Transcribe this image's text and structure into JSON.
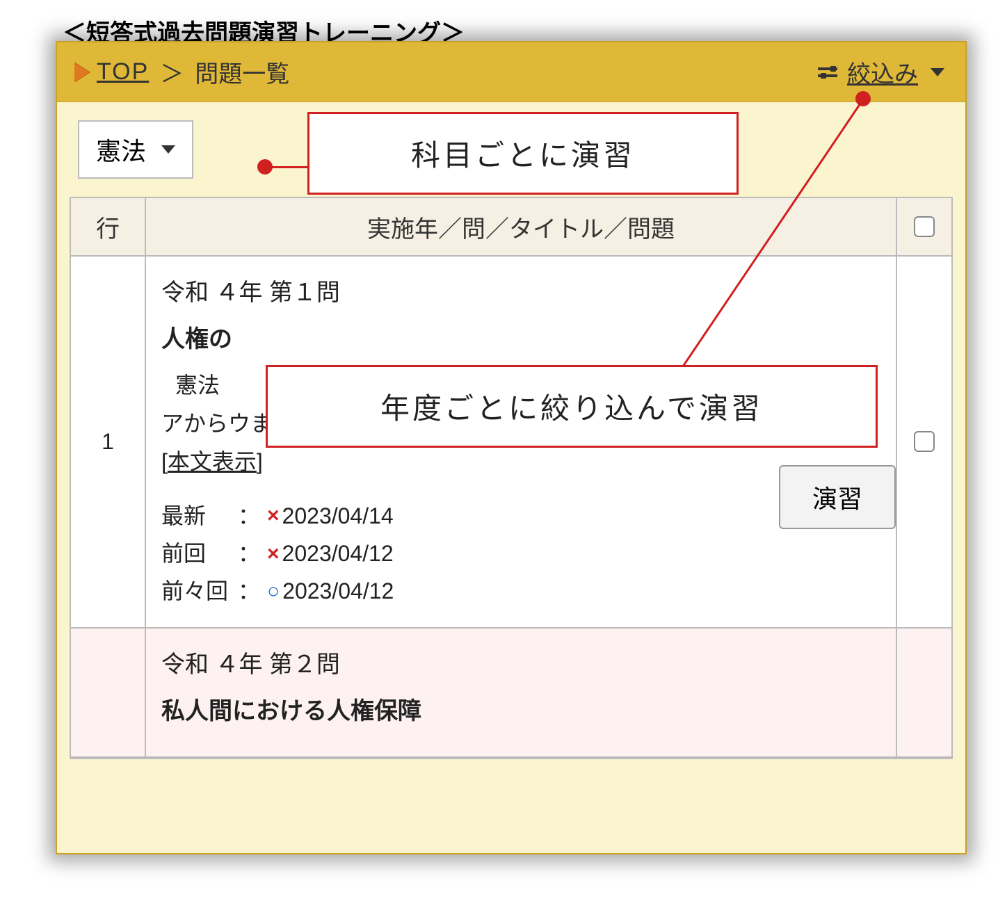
{
  "page_title": "＜短答式過去問題演習トレーニング＞",
  "breadcrumb": {
    "top": "TOP",
    "sep": "＞",
    "current": "問題一覧"
  },
  "filter": {
    "label": "絞込み"
  },
  "subject_dropdown": {
    "selected": "憲法"
  },
  "callouts": {
    "subject": "科目ごとに演習",
    "year": "年度ごとに絞り込んで演習"
  },
  "table": {
    "headers": {
      "row": "行",
      "main": "実施年／問／タイトル／問題"
    },
    "rows": [
      {
        "num": "1",
        "year_q": "令和 ４年 第１問",
        "title": "人権の",
        "subtitle_indent": "憲法",
        "desc": "アからウまでの各記述について、最高裁判所の判例の…",
        "show_body": "本文表示",
        "history": {
          "latest_label": "最新",
          "latest_mark": "×",
          "latest_date": "2023/04/14",
          "prev_label": "前回",
          "prev_mark": "×",
          "prev_date": "2023/04/12",
          "prev2_label": "前々回",
          "prev2_mark": "○",
          "prev2_date": "2023/04/12"
        },
        "exercise_btn": "演習"
      },
      {
        "num": "",
        "year_q": "令和 ４年 第２問",
        "title": "私人間における人権保障"
      }
    ]
  }
}
